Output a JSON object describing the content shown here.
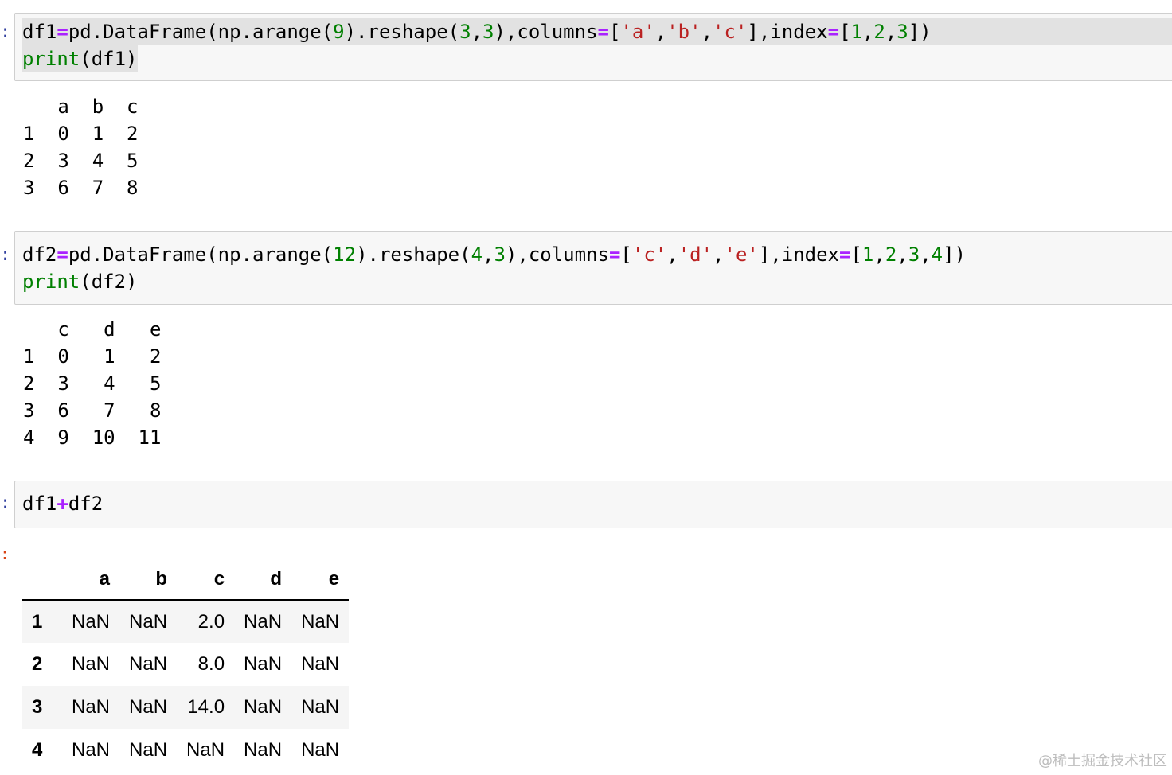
{
  "cells": [
    {
      "code_lines": [
        [
          {
            "t": "df1",
            "c": ""
          },
          {
            "t": "=",
            "c": "op"
          },
          {
            "t": "pd.DataFrame(np.arange(",
            "c": ""
          },
          {
            "t": "9",
            "c": "num"
          },
          {
            "t": ").reshape(",
            "c": ""
          },
          {
            "t": "3",
            "c": "num"
          },
          {
            "t": ",",
            "c": ""
          },
          {
            "t": "3",
            "c": "num"
          },
          {
            "t": "),columns",
            "c": ""
          },
          {
            "t": "=",
            "c": "op"
          },
          {
            "t": "[",
            "c": ""
          },
          {
            "t": "'a'",
            "c": "str"
          },
          {
            "t": ",",
            "c": ""
          },
          {
            "t": "'b'",
            "c": "str"
          },
          {
            "t": ",",
            "c": ""
          },
          {
            "t": "'c'",
            "c": "str"
          },
          {
            "t": "],index",
            "c": ""
          },
          {
            "t": "=",
            "c": "op"
          },
          {
            "t": "[",
            "c": ""
          },
          {
            "t": "1",
            "c": "num"
          },
          {
            "t": ",",
            "c": ""
          },
          {
            "t": "2",
            "c": "num"
          },
          {
            "t": ",",
            "c": ""
          },
          {
            "t": "3",
            "c": "num"
          },
          {
            "t": "])",
            "c": ""
          }
        ],
        [
          {
            "t": "print",
            "c": "kw"
          },
          {
            "t": "(df1)",
            "c": ""
          }
        ]
      ],
      "output_rows": [
        "   a  b  c",
        "1  0  1  2",
        "2  3  4  5",
        "3  6  7  8"
      ]
    },
    {
      "code_lines": [
        [
          {
            "t": "df2",
            "c": ""
          },
          {
            "t": "=",
            "c": "op"
          },
          {
            "t": "pd.DataFrame(np.arange(",
            "c": ""
          },
          {
            "t": "12",
            "c": "num"
          },
          {
            "t": ").reshape(",
            "c": ""
          },
          {
            "t": "4",
            "c": "num"
          },
          {
            "t": ",",
            "c": ""
          },
          {
            "t": "3",
            "c": "num"
          },
          {
            "t": "),columns",
            "c": ""
          },
          {
            "t": "=",
            "c": "op"
          },
          {
            "t": "[",
            "c": ""
          },
          {
            "t": "'c'",
            "c": "str"
          },
          {
            "t": ",",
            "c": ""
          },
          {
            "t": "'d'",
            "c": "str"
          },
          {
            "t": ",",
            "c": ""
          },
          {
            "t": "'e'",
            "c": "str"
          },
          {
            "t": "],index",
            "c": ""
          },
          {
            "t": "=",
            "c": "op"
          },
          {
            "t": "[",
            "c": ""
          },
          {
            "t": "1",
            "c": "num"
          },
          {
            "t": ",",
            "c": ""
          },
          {
            "t": "2",
            "c": "num"
          },
          {
            "t": ",",
            "c": ""
          },
          {
            "t": "3",
            "c": "num"
          },
          {
            "t": ",",
            "c": ""
          },
          {
            "t": "4",
            "c": "num"
          },
          {
            "t": "])",
            "c": ""
          }
        ],
        [
          {
            "t": "print",
            "c": "kw"
          },
          {
            "t": "(df2)",
            "c": ""
          }
        ]
      ],
      "output_rows": [
        "   c   d   e",
        "1  0   1   2",
        "2  3   4   5",
        "3  6   7   8",
        "4  9  10  11"
      ]
    },
    {
      "code_lines": [
        [
          {
            "t": "df1",
            "c": ""
          },
          {
            "t": "+",
            "c": "op"
          },
          {
            "t": "df2",
            "c": ""
          }
        ]
      ]
    }
  ],
  "result_table": {
    "columns": [
      "",
      "a",
      "b",
      "c",
      "d",
      "e"
    ],
    "rows": [
      {
        "index": "1",
        "values": [
          "NaN",
          "NaN",
          "2.0",
          "NaN",
          "NaN"
        ]
      },
      {
        "index": "2",
        "values": [
          "NaN",
          "NaN",
          "8.0",
          "NaN",
          "NaN"
        ]
      },
      {
        "index": "3",
        "values": [
          "NaN",
          "NaN",
          "14.0",
          "NaN",
          "NaN"
        ]
      },
      {
        "index": "4",
        "values": [
          "NaN",
          "NaN",
          "NaN",
          "NaN",
          "NaN"
        ]
      }
    ]
  },
  "prompts": {
    "input_colon": ":",
    "output_colon": ":"
  },
  "watermark": "@稀土掘金技术社区"
}
